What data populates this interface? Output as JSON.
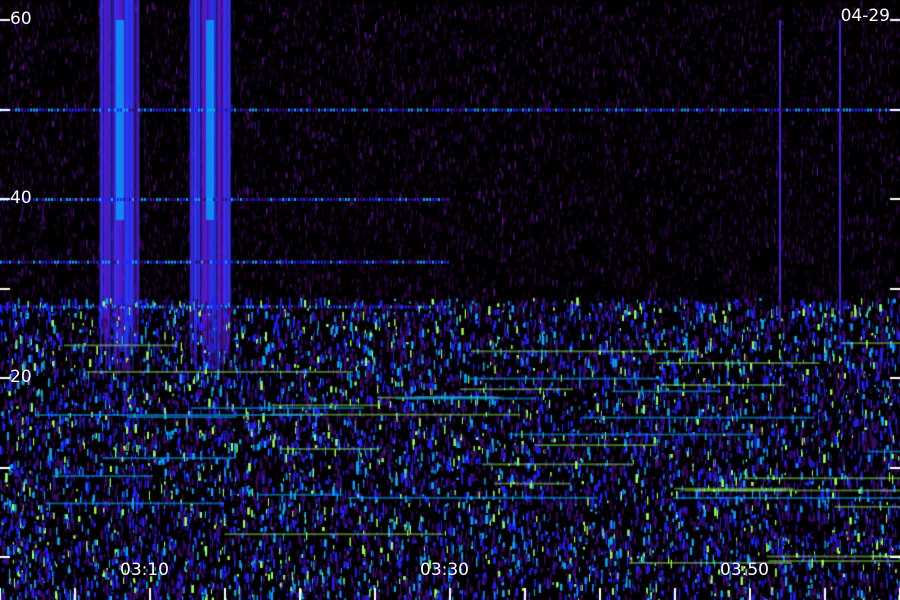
{
  "chart_data": {
    "type": "heatmap",
    "date": "04-29",
    "xlim": [
      "03:00",
      "04:00"
    ],
    "ylim": [
      0,
      60
    ],
    "x_tick_labels": [
      "03:10",
      "03:30",
      "03:50"
    ],
    "y_tick_labels": [
      "60",
      "40",
      "20"
    ],
    "x_minor_ticks_minutes": 5,
    "y_major_ticks": [
      0,
      10,
      20,
      30,
      40,
      50,
      60
    ],
    "colors": {
      "background": "#000000",
      "low": "#3a0a6b",
      "mid": "#2020ff",
      "high": "#00aaff",
      "peak": "#9aff55",
      "tick": "#ffffff"
    },
    "features": {
      "noise_band_top_y": 29,
      "horizontal_lines_y": [
        50,
        40,
        33,
        28
      ],
      "horizontal_lines_end_time": "03:30",
      "vertical_bursts_times": [
        "03:08",
        "03:14"
      ],
      "vertical_lines_times": [
        "03:52",
        "03:56"
      ]
    }
  }
}
